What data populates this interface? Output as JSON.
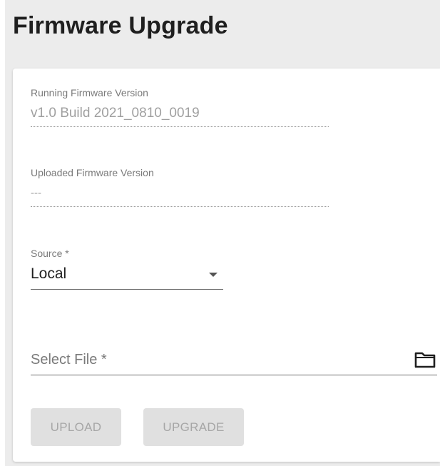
{
  "page": {
    "title": "Firmware Upgrade"
  },
  "running_version": {
    "label": "Running Firmware Version",
    "value": "v1.0 Build 2021_0810_0019"
  },
  "uploaded_version": {
    "label": "Uploaded Firmware Version",
    "value": "---"
  },
  "source": {
    "label": "Source *",
    "value": "Local"
  },
  "file": {
    "placeholder": "Select File *",
    "icon": "folder-icon"
  },
  "buttons": {
    "upload_label": "UPLOAD",
    "upgrade_label": "UPGRADE"
  },
  "colors": {
    "page_bg": "#ececec",
    "card_bg": "#ffffff",
    "disabled_button": "#e0e0e0"
  }
}
